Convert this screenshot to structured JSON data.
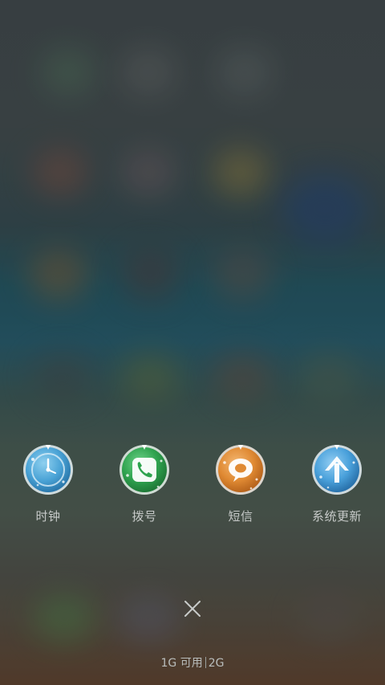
{
  "shortcuts": [
    {
      "label": "时钟",
      "icon": "clock-icon",
      "color": "#4aa3d6"
    },
    {
      "label": "拨号",
      "icon": "phone-icon",
      "color": "#2fa34f"
    },
    {
      "label": "短信",
      "icon": "message-icon",
      "color": "#e08a33"
    },
    {
      "label": "系统更新",
      "icon": "update-arrow-icon",
      "color": "#4aa1db"
    }
  ],
  "memory": {
    "available": "1G 可用",
    "total": "2G"
  },
  "colors": {
    "label_text": "#c6c9c8",
    "close_icon": "#c9cccb"
  }
}
